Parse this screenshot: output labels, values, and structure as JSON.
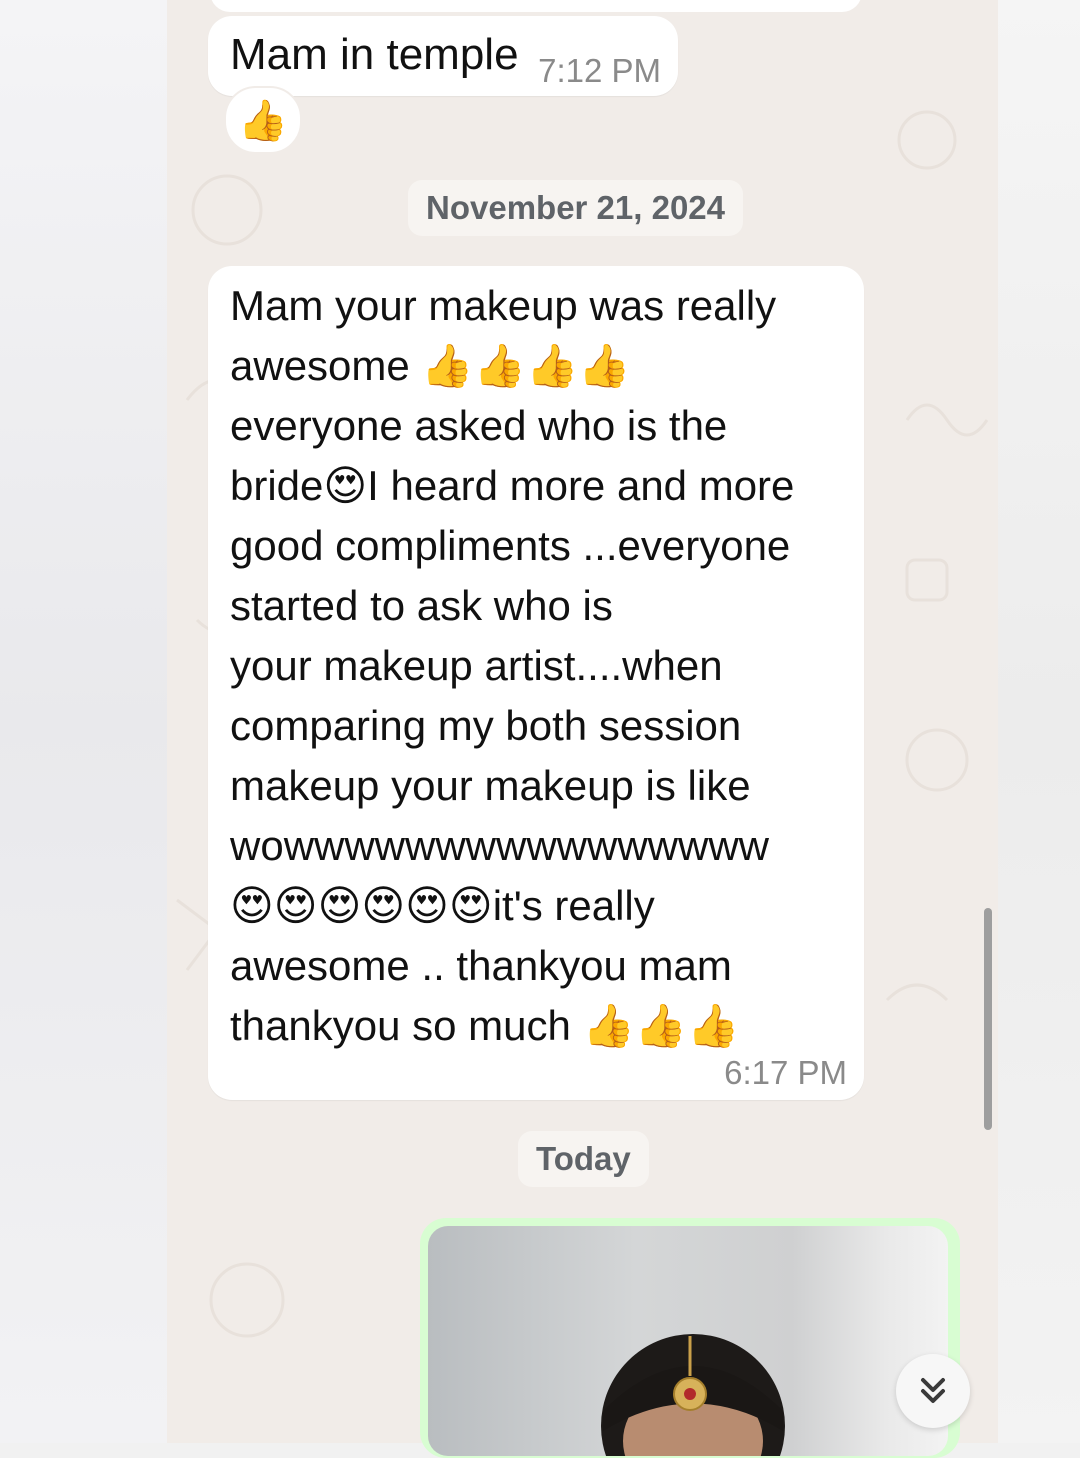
{
  "messages": [
    {
      "text": "Mam in temple",
      "time": "7:12 PM",
      "reaction": "👍"
    },
    {
      "lines": [
        "Mam your makeup was really",
        "awesome 👍👍👍👍",
        "everyone asked who is the",
        "bride😍I heard more and more",
        "good compliments ...everyone",
        "started to ask who is",
        "your makeup artist....when",
        "comparing my both session",
        "makeup your makeup is like",
        "wowwwwwwwwwwwwwwww",
        "😍😍😍😍😍😍it's really",
        "awesome .. thankyou mam",
        "thankyou so much 👍👍👍"
      ],
      "time": "6:17 PM"
    }
  ],
  "dates": {
    "first": "November 21, 2024",
    "second": "Today"
  },
  "icons": {
    "scroll_down": "double-chevron-down-icon",
    "reaction": "thumbs-up-icon"
  },
  "colors": {
    "chat_bg": "#f1ece8",
    "incoming_bubble": "#ffffff",
    "outgoing_bubble": "#d8fdd2",
    "timestamp": "#8a8a8a"
  }
}
